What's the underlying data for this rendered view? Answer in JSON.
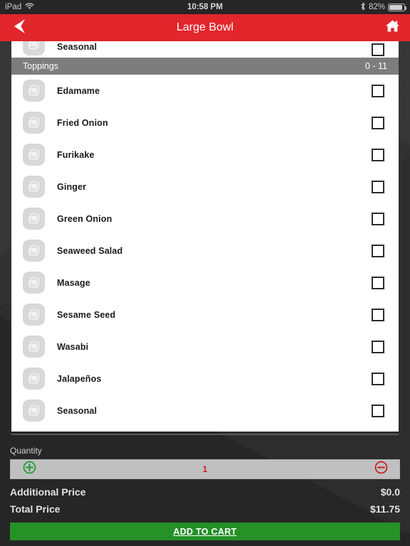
{
  "status_bar": {
    "device": "iPad",
    "wifi_icon": "wifi-icon",
    "time": "10:58 PM",
    "bluetooth_icon": "bluetooth-icon",
    "battery_percent": "82%",
    "battery_icon": "battery-icon"
  },
  "nav": {
    "back_icon": "back-arrow-icon",
    "title": "Large Bowl",
    "home_icon": "home-icon"
  },
  "list": {
    "top_partial_item": {
      "label": "Seasonal",
      "thumb_icon": "image-placeholder-icon",
      "checked": false
    },
    "section": {
      "title": "Toppings",
      "count": "0 - 11"
    },
    "items": [
      {
        "label": "Edamame",
        "thumb_icon": "image-placeholder-icon",
        "checked": false
      },
      {
        "label": "Fried Onion",
        "thumb_icon": "image-placeholder-icon",
        "checked": false
      },
      {
        "label": "Furikake",
        "thumb_icon": "image-placeholder-icon",
        "checked": false
      },
      {
        "label": "Ginger",
        "thumb_icon": "image-placeholder-icon",
        "checked": false
      },
      {
        "label": "Green Onion",
        "thumb_icon": "image-placeholder-icon",
        "checked": false
      },
      {
        "label": "Seaweed Salad",
        "thumb_icon": "image-placeholder-icon",
        "checked": false
      },
      {
        "label": "Masage",
        "thumb_icon": "image-placeholder-icon",
        "checked": false
      },
      {
        "label": "Sesame Seed",
        "thumb_icon": "image-placeholder-icon",
        "checked": false
      },
      {
        "label": "Wasabi",
        "thumb_icon": "image-placeholder-icon",
        "checked": false
      },
      {
        "label": "Jalapeños",
        "thumb_icon": "image-placeholder-icon",
        "checked": false
      },
      {
        "label": "Seasonal",
        "thumb_icon": "image-placeholder-icon",
        "checked": false
      }
    ]
  },
  "footer": {
    "quantity_label": "Quantity",
    "increment_icon": "plus-circle-icon",
    "decrement_icon": "minus-circle-icon",
    "quantity_value": "1",
    "additional_price_label": "Additional Price",
    "additional_price_value": "$0.0",
    "total_price_label": "Total Price",
    "total_price_value": "$11.75",
    "add_to_cart_label": "ADD TO CART"
  },
  "colors": {
    "brand_red": "#e1262c",
    "section_gray": "#7d7d7d",
    "cart_green": "#259127",
    "accent_red": "#cc1f1f",
    "bg_dark": "#2d2d2d"
  }
}
